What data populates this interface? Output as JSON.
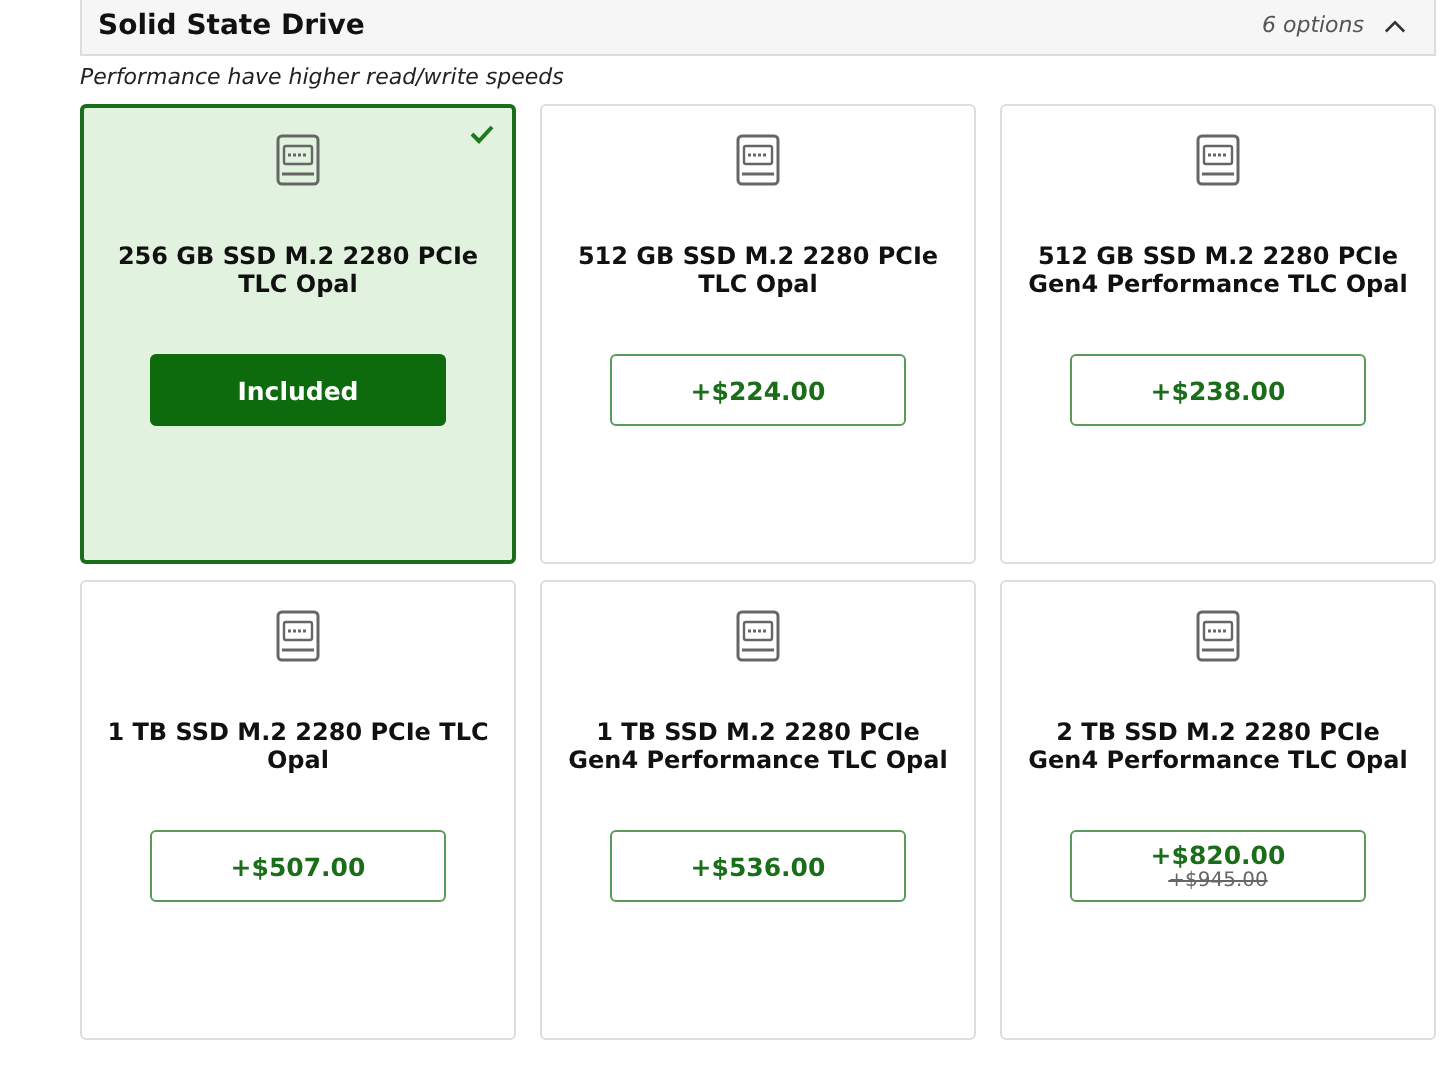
{
  "section": {
    "title": "Solid State Drive",
    "count": "6 options",
    "expanded": true
  },
  "note": "Performance have higher read/write speeds",
  "options": [
    {
      "name": "256 GB SSD M.2 2280 PCIe TLC Opal",
      "price": "Included",
      "selected": true
    },
    {
      "name": "512 GB SSD M.2 2280 PCIe TLC Opal",
      "price": "+$224.00",
      "selected": false
    },
    {
      "name": "512 GB SSD M.2 2280 PCIe Gen4 Performance TLC Opal",
      "price": "+$238.00",
      "selected": false
    },
    {
      "name": "1 TB SSD M.2 2280 PCIe TLC Opal",
      "price": "+$507.00",
      "selected": false
    },
    {
      "name": "1 TB SSD M.2 2280 PCIe Gen4 Performance TLC Opal",
      "price": "+$536.00",
      "selected": false
    },
    {
      "name": "2 TB SSD M.2 2280 PCIe Gen4 Performance TLC Opal",
      "price": "+$820.00",
      "old_price": "+$945.00",
      "selected": false
    }
  ]
}
